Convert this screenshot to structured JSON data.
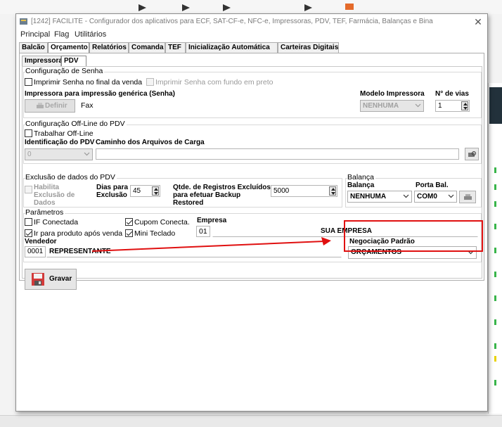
{
  "window": {
    "title": "[1242] FACILITE - Configurador dos aplicativos para ECF, SAT-CF-e, NFC-e, Impressoras, PDV, TEF, Farmácia, Balanças e Bina",
    "close": "✕"
  },
  "menu": [
    "Principal",
    "Flag",
    "Utilitários"
  ],
  "tabs": [
    "Balcão",
    "Orçamento",
    "Relatórios",
    "Comanda",
    "TEF",
    "Inicialização Automática",
    "Carteiras Digitais"
  ],
  "subtabs": [
    "Impressora",
    "PDV"
  ],
  "senha": {
    "group": "Configuração de Senha",
    "imprimir_final": "Imprimir Senha no final da venda",
    "imprimir_fundo": "Imprimir Senha com fundo em preto",
    "impressora_label": "Impressora para impressão genérica (Senha)",
    "definir": "Definir",
    "impressora_value": "Fax",
    "modelo_label": "Modelo Impressora",
    "modelo_value": "NENHUMA",
    "vias_label": "N° de vias",
    "vias_value": "1"
  },
  "offline": {
    "group": "Configuração Off-Line do PDV",
    "trabalhar": "Trabalhar Off-Line",
    "ident_label": "Identificação do PDV",
    "ident_value": "0",
    "caminho_label": "Caminho dos Arquivos de Carga",
    "caminho_value": ""
  },
  "exclusao": {
    "group": "Exclusão de dados do PDV",
    "habilita": "Habilita Exclusão de Dados",
    "dias_label": "Dias para Exclusão",
    "dias_value": "45",
    "qtde_label": "Qtde. de Registros Excluídos para efetuar Backup Restored",
    "qtde_value": "5000"
  },
  "balanca": {
    "group": "Balança",
    "balanca_label": "Balança",
    "balanca_value": "NENHUMA",
    "porta_label": "Porta Bal.",
    "porta_value": "COM0"
  },
  "parametros": {
    "group": "Parâmetros",
    "if_conectada": "IF Conectada",
    "cupom_conecta": "Cupom Conecta.",
    "ir_produto": "Ir para produto após venda",
    "mini_teclado": "Mini Teclado",
    "empresa_label": "Empresa",
    "empresa_code": "01",
    "empresa_name": "SUA EMPRESA",
    "vendedor_label": "Vendedor",
    "vendedor_code": "0001",
    "vendedor_name": "REPRESENTANTE",
    "negociacao_label": "Negociação Padrão",
    "negociacao_value": "ORÇAMENTOS"
  },
  "gravar": "Gravar",
  "colors": {
    "highlight": "#e01010",
    "arrow": "#e01010",
    "accent_green": "#39b54a"
  }
}
